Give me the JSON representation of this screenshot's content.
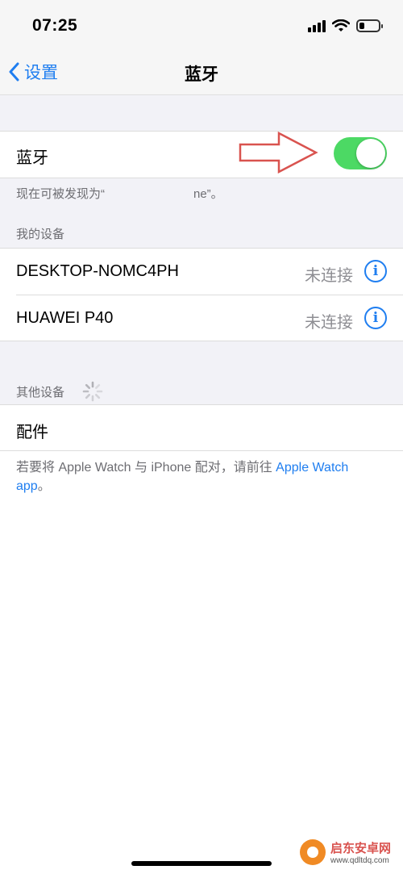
{
  "status_bar": {
    "time": "07:25"
  },
  "nav": {
    "back_label": "设置",
    "title": "蓝牙"
  },
  "bluetooth": {
    "label": "蓝牙",
    "enabled": true,
    "discoverable_prefix": "现在可被发现为“",
    "discoverable_suffix": "ne”。"
  },
  "my_devices": {
    "header": "我的设备",
    "items": [
      {
        "name": "DESKTOP-NOMC4PH",
        "status": "未连接"
      },
      {
        "name": "HUAWEI P40",
        "status": "未连接"
      }
    ]
  },
  "other_devices": {
    "header": "其他设备",
    "items": [
      {
        "name": "配件"
      }
    ]
  },
  "footnote": {
    "text": "若要将 Apple Watch 与 iPhone 配对，请前往 ",
    "link": "Apple Watch app",
    "end": "。"
  },
  "watermark": {
    "name": "启东安卓网",
    "url": "www.qdltdq.com"
  },
  "colors": {
    "accent": "#1f7ef0",
    "toggle_on": "#4cd964",
    "annotation_arrow": "#d9534f"
  }
}
